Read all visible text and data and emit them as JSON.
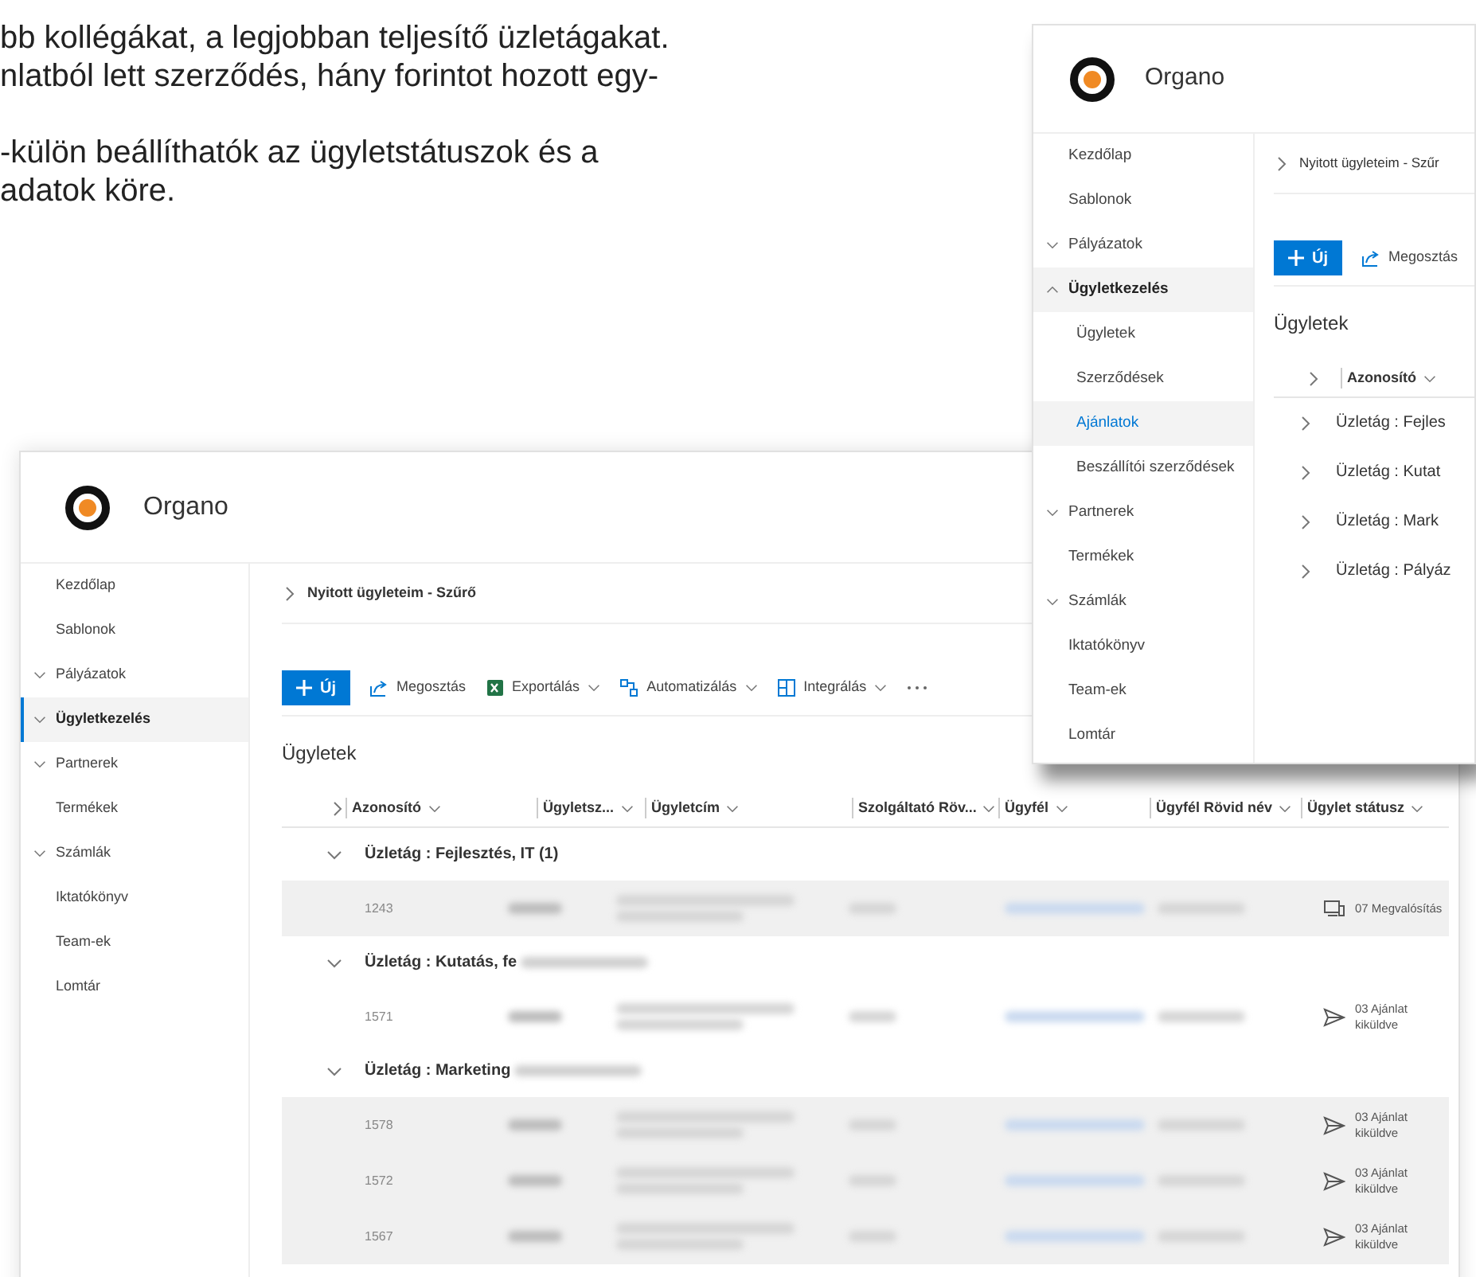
{
  "intro_text": [
    "bb kollégákat, a legjobban teljesítő üzletágakat.",
    "nlatból lett szerződés, hány forintot hozott egy-",
    "-külön beállíthatók az ügyletstátuszok és a",
    "adatok köre."
  ],
  "back_window": {
    "site_title": "Organo",
    "nav": [
      {
        "label": "Kezdőlap",
        "selected": false
      },
      {
        "label": "Sablonok",
        "selected": false
      },
      {
        "label": "Pályázatok",
        "expanded": false,
        "selected": false
      },
      {
        "label": "Ügyletkezelés",
        "expanded": false,
        "selected": true
      },
      {
        "label": "Partnerek",
        "expanded": false,
        "selected": false
      },
      {
        "label": "Termékek",
        "selected": false
      },
      {
        "label": "Számlák",
        "expanded": false,
        "selected": false
      },
      {
        "label": "Iktatókönyv",
        "selected": false
      },
      {
        "label": "Team-ek",
        "selected": false
      },
      {
        "label": "Lomtár",
        "selected": false
      }
    ],
    "breadcrumb": "Nyitott ügyleteim - Szűrő",
    "new_button": "Új",
    "toolbar": [
      {
        "label": "Megosztás",
        "kind": "share"
      },
      {
        "label": "Exportálás",
        "kind": "excel",
        "dropdown": true
      },
      {
        "label": "Automatizálás",
        "kind": "flow",
        "dropdown": true
      },
      {
        "label": "Integrálás",
        "kind": "grid",
        "dropdown": true
      }
    ],
    "list_title": "Ügyletek",
    "columns": [
      "Azonosító",
      "Ügyletsz...",
      "Ügyletcím",
      "Szolgáltató Röv...",
      "Ügyfél",
      "Ügyfél Rövid név",
      "Ügylet státusz"
    ],
    "groups": [
      {
        "label": "Üzletág : Fejlesztés, IT (1)",
        "expanded": true,
        "rows": [
          {
            "id": "1243",
            "status": "07 Megvalósítás",
            "kind": "build",
            "highlighted": true
          }
        ]
      },
      {
        "label": "Üzletág : Kutatás, fe",
        "expanded": true,
        "rows": [
          {
            "id": "1571",
            "status": "03 Ajánlat kiküldve",
            "kind": "sent",
            "highlighted": false
          }
        ]
      },
      {
        "label": "Üzletág : Marketing",
        "expanded": true,
        "rows": [
          {
            "id": "1578",
            "status": "03 Ajánlat kiküldve",
            "kind": "sent",
            "highlighted": true
          },
          {
            "id": "1572",
            "status": "03 Ajánlat kiküldve",
            "kind": "sent",
            "highlighted": true
          },
          {
            "id": "1567",
            "status": "03 Ajánlat kiküldve",
            "kind": "sent",
            "highlighted": true
          }
        ]
      }
    ]
  },
  "front_window": {
    "site_title": "Organo",
    "nav": [
      {
        "label": "Kezdőlap",
        "selected": false
      },
      {
        "label": "Sablonok",
        "selected": false
      },
      {
        "label": "Pályázatok",
        "expanded": false,
        "selected": false
      },
      {
        "label": "Ügyletkezelés",
        "expanded": true,
        "selected": false,
        "children": [
          {
            "label": "Ügyletek",
            "selected": false
          },
          {
            "label": "Szerződések",
            "selected": false
          },
          {
            "label": "Ajánlatok",
            "selected": true
          },
          {
            "label": "Beszállítói szerződések",
            "selected": false
          }
        ]
      },
      {
        "label": "Partnerek",
        "expanded": false,
        "selected": false
      },
      {
        "label": "Termékek",
        "selected": false
      },
      {
        "label": "Számlák",
        "expanded": false,
        "selected": false
      },
      {
        "label": "Iktatókönyv",
        "selected": false
      },
      {
        "label": "Team-ek",
        "selected": false
      },
      {
        "label": "Lomtár",
        "selected": false
      }
    ],
    "breadcrumb": "Nyitott ügyleteim - Szűr",
    "new_button": "Új",
    "toolbar": [
      {
        "label": "Megosztás",
        "kind": "share"
      }
    ],
    "list_title": "Ügyletek",
    "columns": [
      "Azonosító"
    ],
    "groups": [
      {
        "label": "Üzletág : Fejles",
        "expanded": false
      },
      {
        "label": "Üzletág : Kutat",
        "expanded": false
      },
      {
        "label": "Üzletág : Mark",
        "expanded": false
      },
      {
        "label": "Üzletág : Pályáz",
        "expanded": false
      }
    ]
  }
}
